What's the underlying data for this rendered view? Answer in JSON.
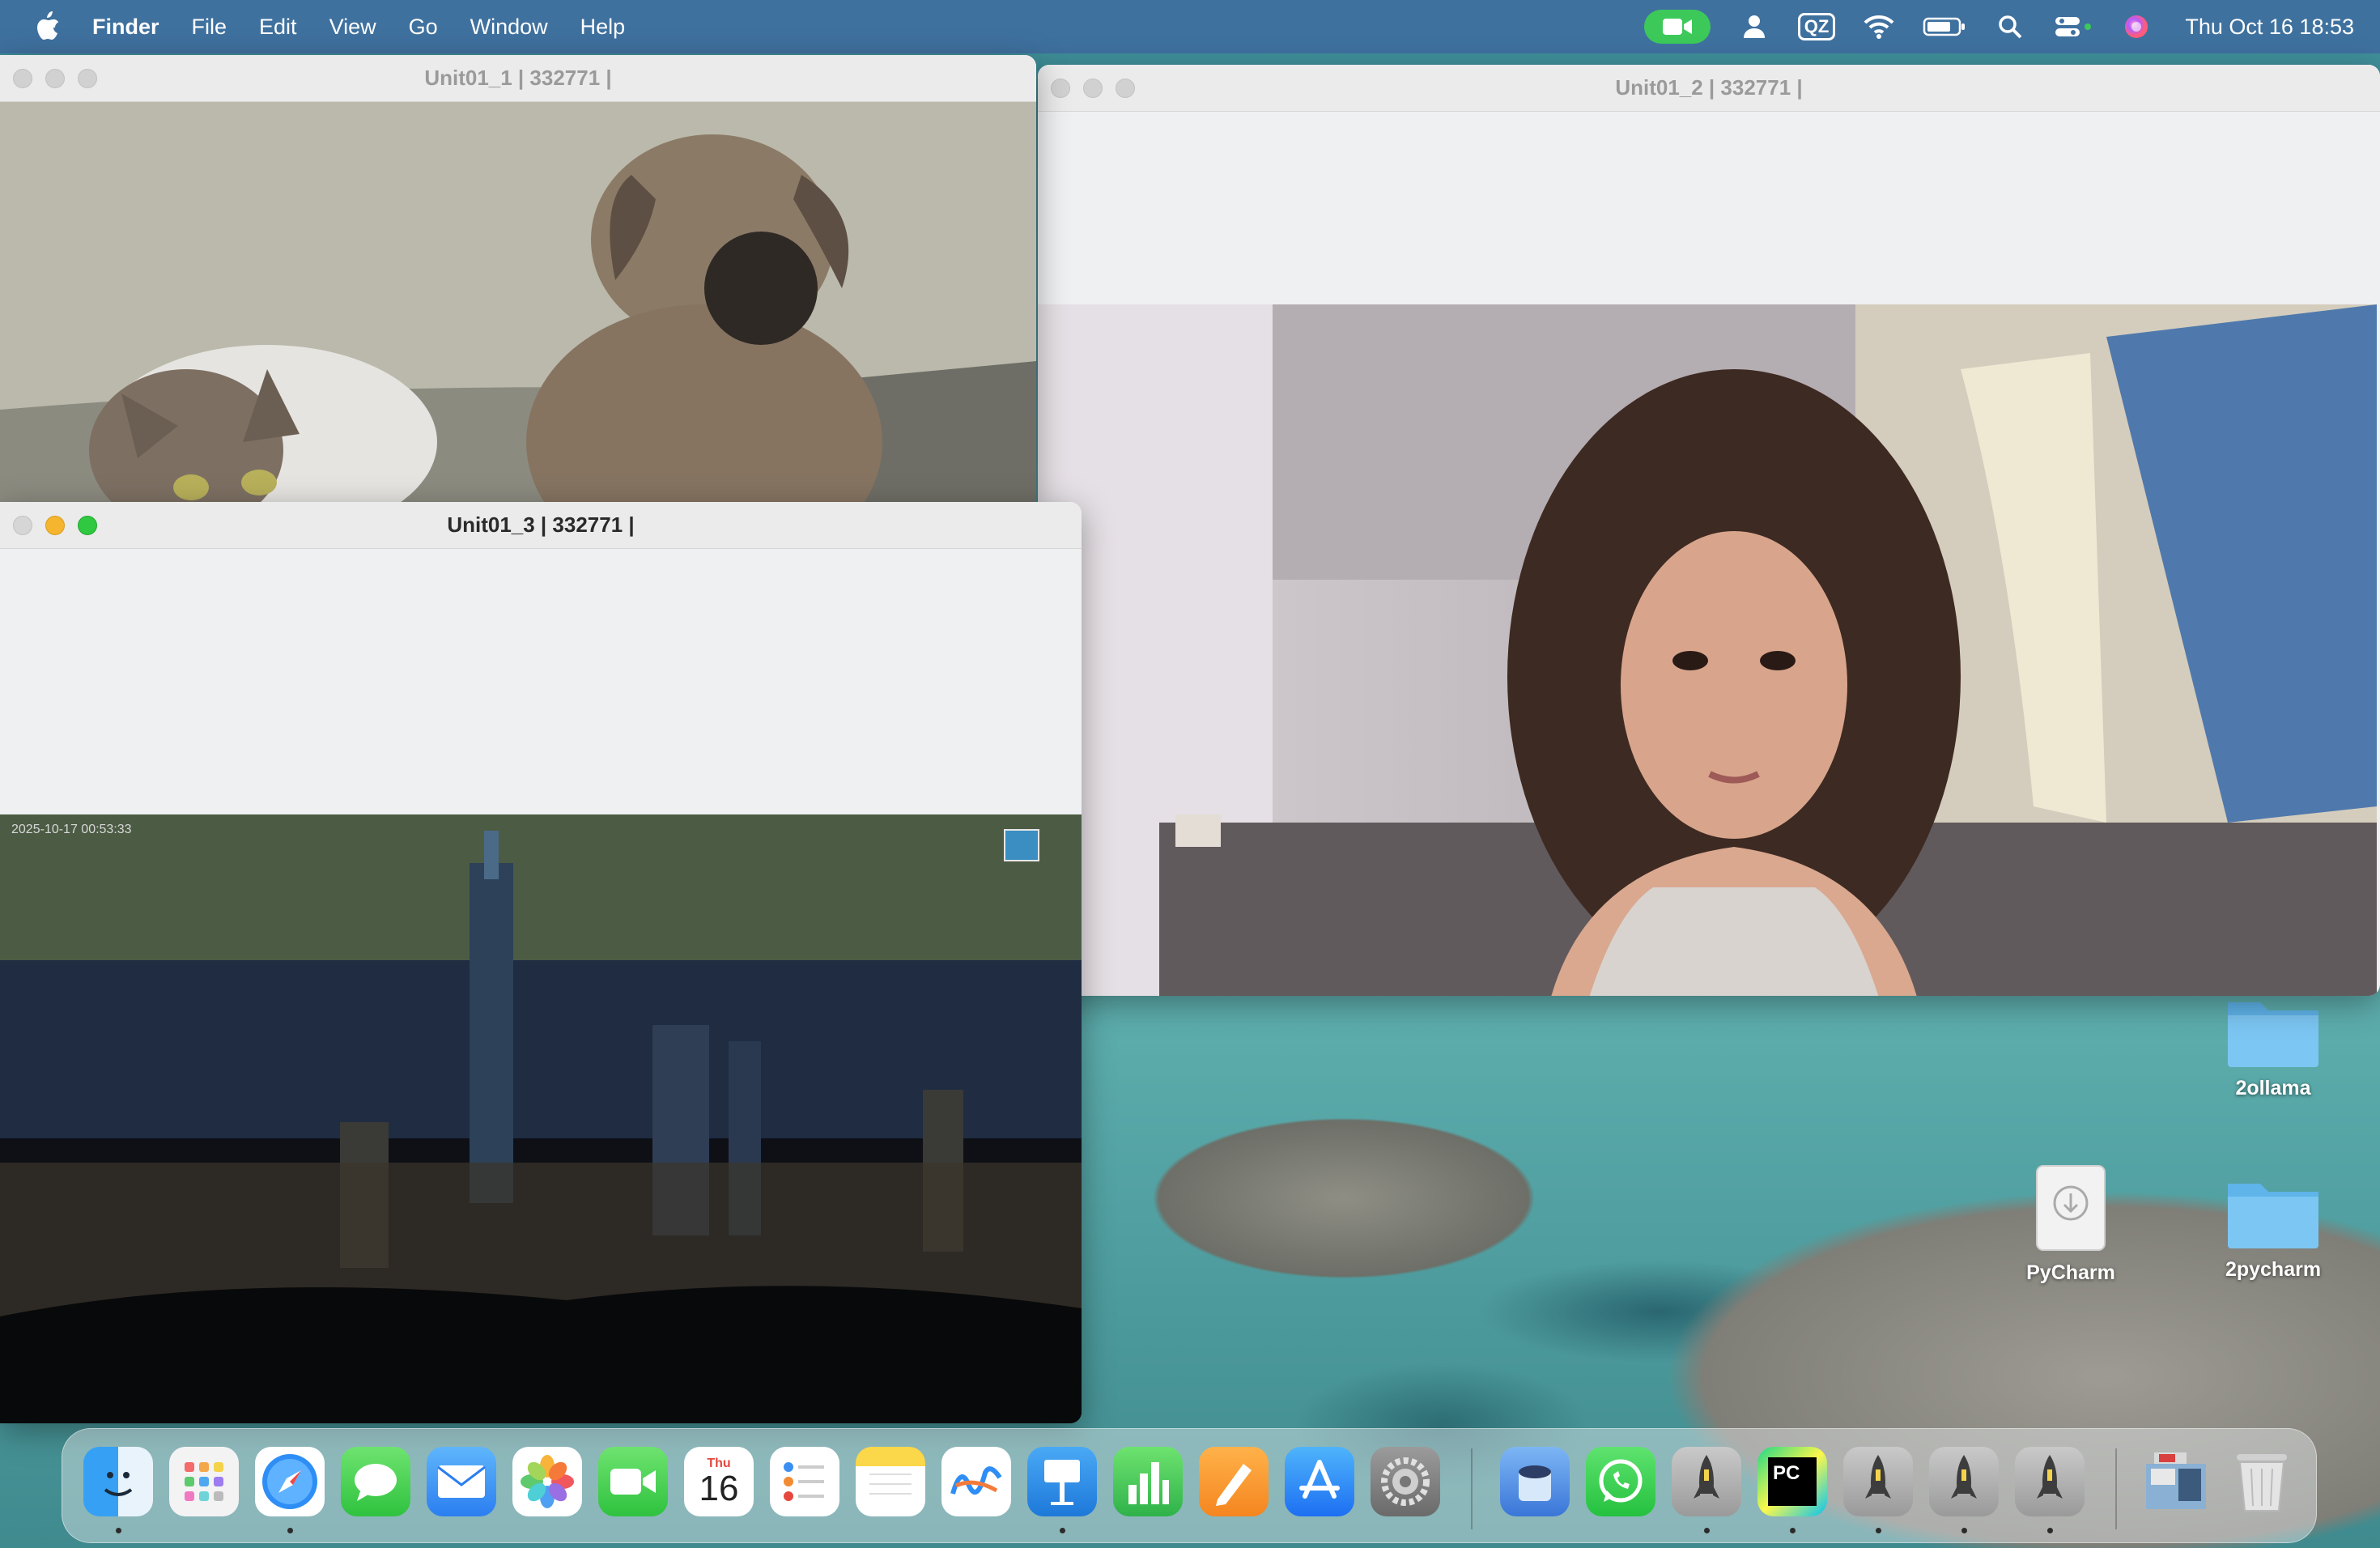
{
  "menubar": {
    "app_name": "Finder",
    "menus": [
      "File",
      "Edit",
      "View",
      "Go",
      "Window",
      "Help"
    ],
    "status_icons": [
      "facetime-camera-icon",
      "user-icon",
      "qz-input-icon",
      "wifi-icon",
      "battery-icon",
      "search-icon",
      "control-center-icon",
      "siri-icon"
    ],
    "qz_label": "QZ",
    "clock": "Thu Oct 16  18:53"
  },
  "windows": {
    "unit1": {
      "title": "Unit01_1 | 332771 |"
    },
    "unit2": {
      "title": "Unit01_2 | 332771 |"
    },
    "unit3": {
      "title": "Unit01_3 | 332771 |",
      "timestamp": "2025-10-17 00:53:33"
    }
  },
  "desktop": {
    "icons": [
      {
        "label": "2ollama",
        "kind": "folder"
      },
      {
        "label": "PyCharm",
        "kind": "disk-image"
      },
      {
        "label": "2pycharm",
        "kind": "folder"
      }
    ]
  },
  "dock": {
    "calendar": {
      "month": "Thu",
      "day": "16"
    },
    "pycharm_badge": "PC",
    "apps": [
      "Finder",
      "Launchpad",
      "Safari",
      "Messages",
      "Mail",
      "Photos",
      "FaceTime",
      "Calendar",
      "Reminders",
      "Notes",
      "Freeform",
      "Keynote",
      "Numbers",
      "Pages",
      "App Store",
      "System Settings",
      "Installer",
      "WhatsApp",
      "Python Launcher",
      "PyCharm",
      "Python Launcher",
      "Python Launcher",
      "Python Launcher",
      "Downloads",
      "Trash"
    ]
  },
  "colors": {
    "menubar": "#3f6fa0",
    "facetime_green": "#3dc95a",
    "traffic_yellow": "#f5b52e",
    "traffic_green": "#2fc840",
    "folder_blue": "#5fb4ea"
  }
}
